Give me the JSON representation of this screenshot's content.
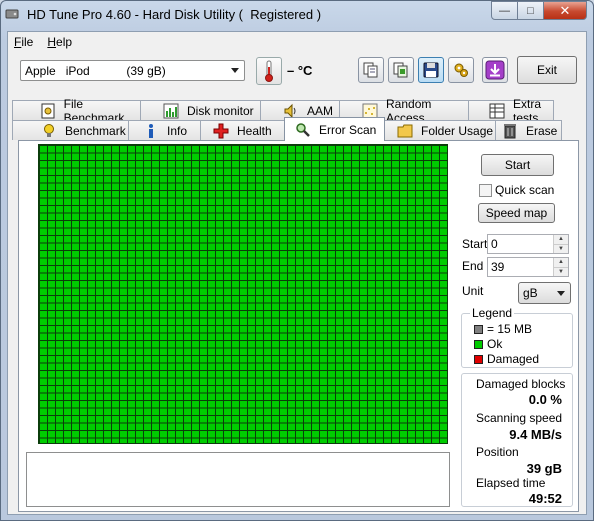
{
  "window": {
    "title": "HD Tune Pro 4.60 - Hard Disk Utility (  Registered )",
    "minimize_glyph": "—",
    "maximize_glyph": "□",
    "close_glyph": "✕"
  },
  "menu": {
    "items": [
      {
        "hotkey": "F",
        "rest": "ile"
      },
      {
        "hotkey": "H",
        "rest": "elp"
      }
    ]
  },
  "toolbar": {
    "drive": "Apple   iPod           (39 gB)",
    "temperature": "– °C",
    "exit_label": "Exit"
  },
  "tabs": {
    "top_row": [
      "File Benchmark",
      "Disk monitor",
      "AAM",
      "Random Access",
      "Extra tests"
    ],
    "bottom_row": [
      "Benchmark",
      "Info",
      "Health",
      "Error Scan",
      "Folder Usage",
      "Erase"
    ],
    "active": "Error Scan"
  },
  "controls": {
    "start_button": "Start",
    "quick_scan_label": "Quick scan",
    "quick_scan_checked": false,
    "speed_map_button": "Speed map",
    "start_label": "Start",
    "start_value": "0",
    "end_label": "End",
    "end_value": "39",
    "unit_label": "Unit",
    "unit_value": "gB"
  },
  "legend": {
    "title": "Legend",
    "block_size": "= 15 MB",
    "ok": "Ok",
    "damaged": "Damaged",
    "colors": {
      "block": "#808080",
      "ok": "#00cc00",
      "damaged": "#e00000"
    }
  },
  "stats": {
    "damaged_blocks_label": "Damaged blocks",
    "damaged_blocks_value": "0.0 %",
    "scanning_speed_label": "Scanning speed",
    "scanning_speed_value": "9.4 MB/s",
    "position_label": "Position",
    "position_value": "39 gB",
    "elapsed_label": "Elapsed time",
    "elapsed_value": "49:52"
  },
  "scan_grid": {
    "block_color": "#00cc00",
    "status": "all blocks ok"
  }
}
